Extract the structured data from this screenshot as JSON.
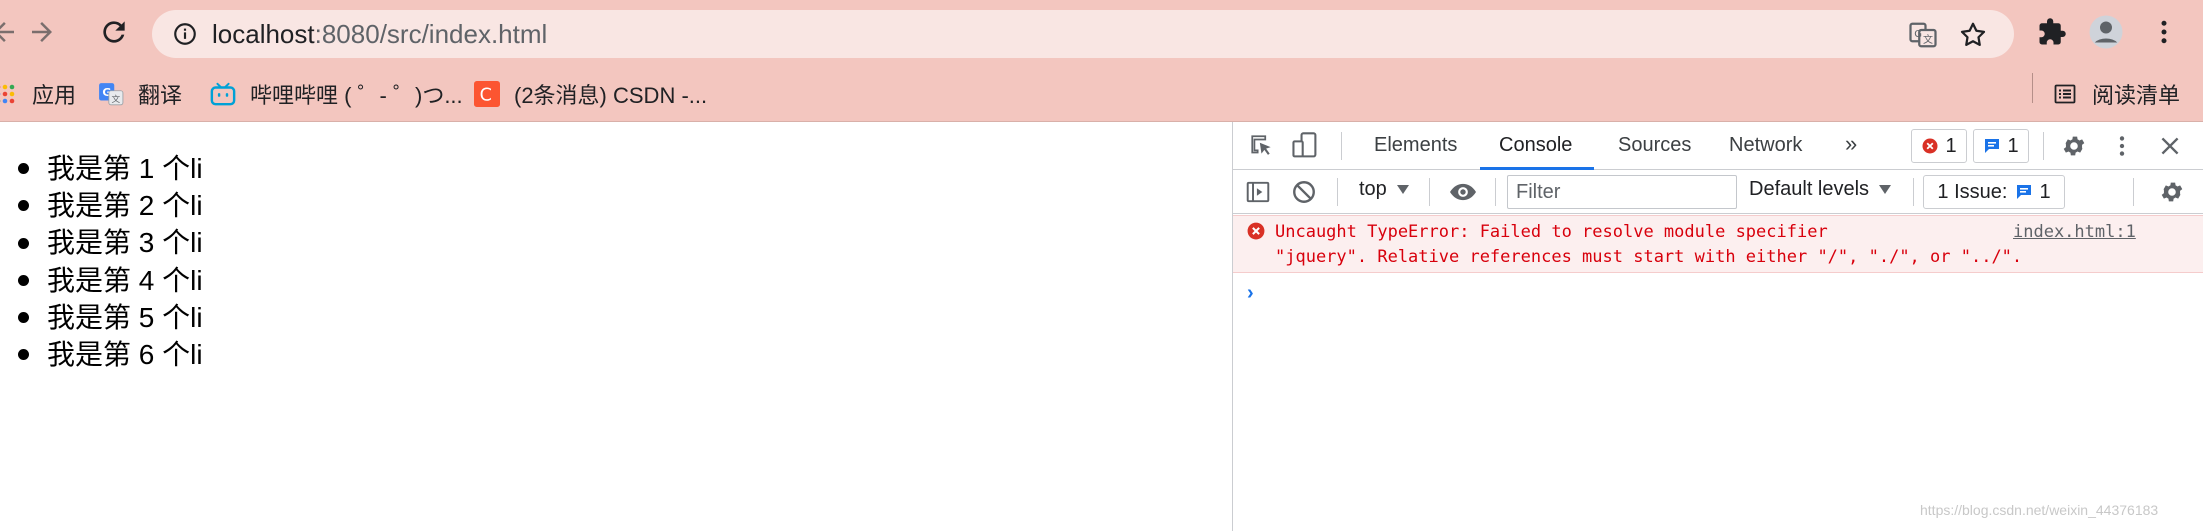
{
  "browser": {
    "url_host": "localhost",
    "url_rest": ":8080/src/index.html",
    "bookmarks": [
      {
        "label": "应用",
        "icon": "apps-grid-icon"
      },
      {
        "label": "翻译",
        "icon": "google-translate-icon"
      },
      {
        "label": "哔哩哔哩 ( ゜- ゜)つ...",
        "icon": "bilibili-icon"
      },
      {
        "label": "(2条消息) CSDN -...",
        "icon": "csdn-icon"
      }
    ],
    "reading_list": "阅读清单"
  },
  "page": {
    "items": [
      "我是第 1 个li",
      "我是第 2 个li",
      "我是第 3 个li",
      "我是第 4 个li",
      "我是第 5 个li",
      "我是第 6 个li"
    ]
  },
  "devtools": {
    "tabs": [
      "Elements",
      "Console",
      "Sources",
      "Network"
    ],
    "active_tab": "Console",
    "error_count": "1",
    "message_count": "1",
    "context": "top",
    "filter_placeholder": "Filter",
    "levels": "Default levels",
    "issues_label": "1 Issue:",
    "issues_count": "1",
    "error": {
      "line1": "Uncaught TypeError: Failed to resolve module specifier",
      "line2": "\"jquery\". Relative references must start with either \"/\", \"./\", or \"../\".",
      "source": "index.html:1"
    },
    "prompt": "›"
  },
  "colors": {
    "chrome_bg": "#f3c6bf",
    "omnibox_bg": "#f9e6e3",
    "accent": "#1a73e8",
    "error_text": "#d8000c",
    "error_bg": "#fcefef"
  },
  "watermark": "https://blog.csdn.net/weixin_44376183"
}
